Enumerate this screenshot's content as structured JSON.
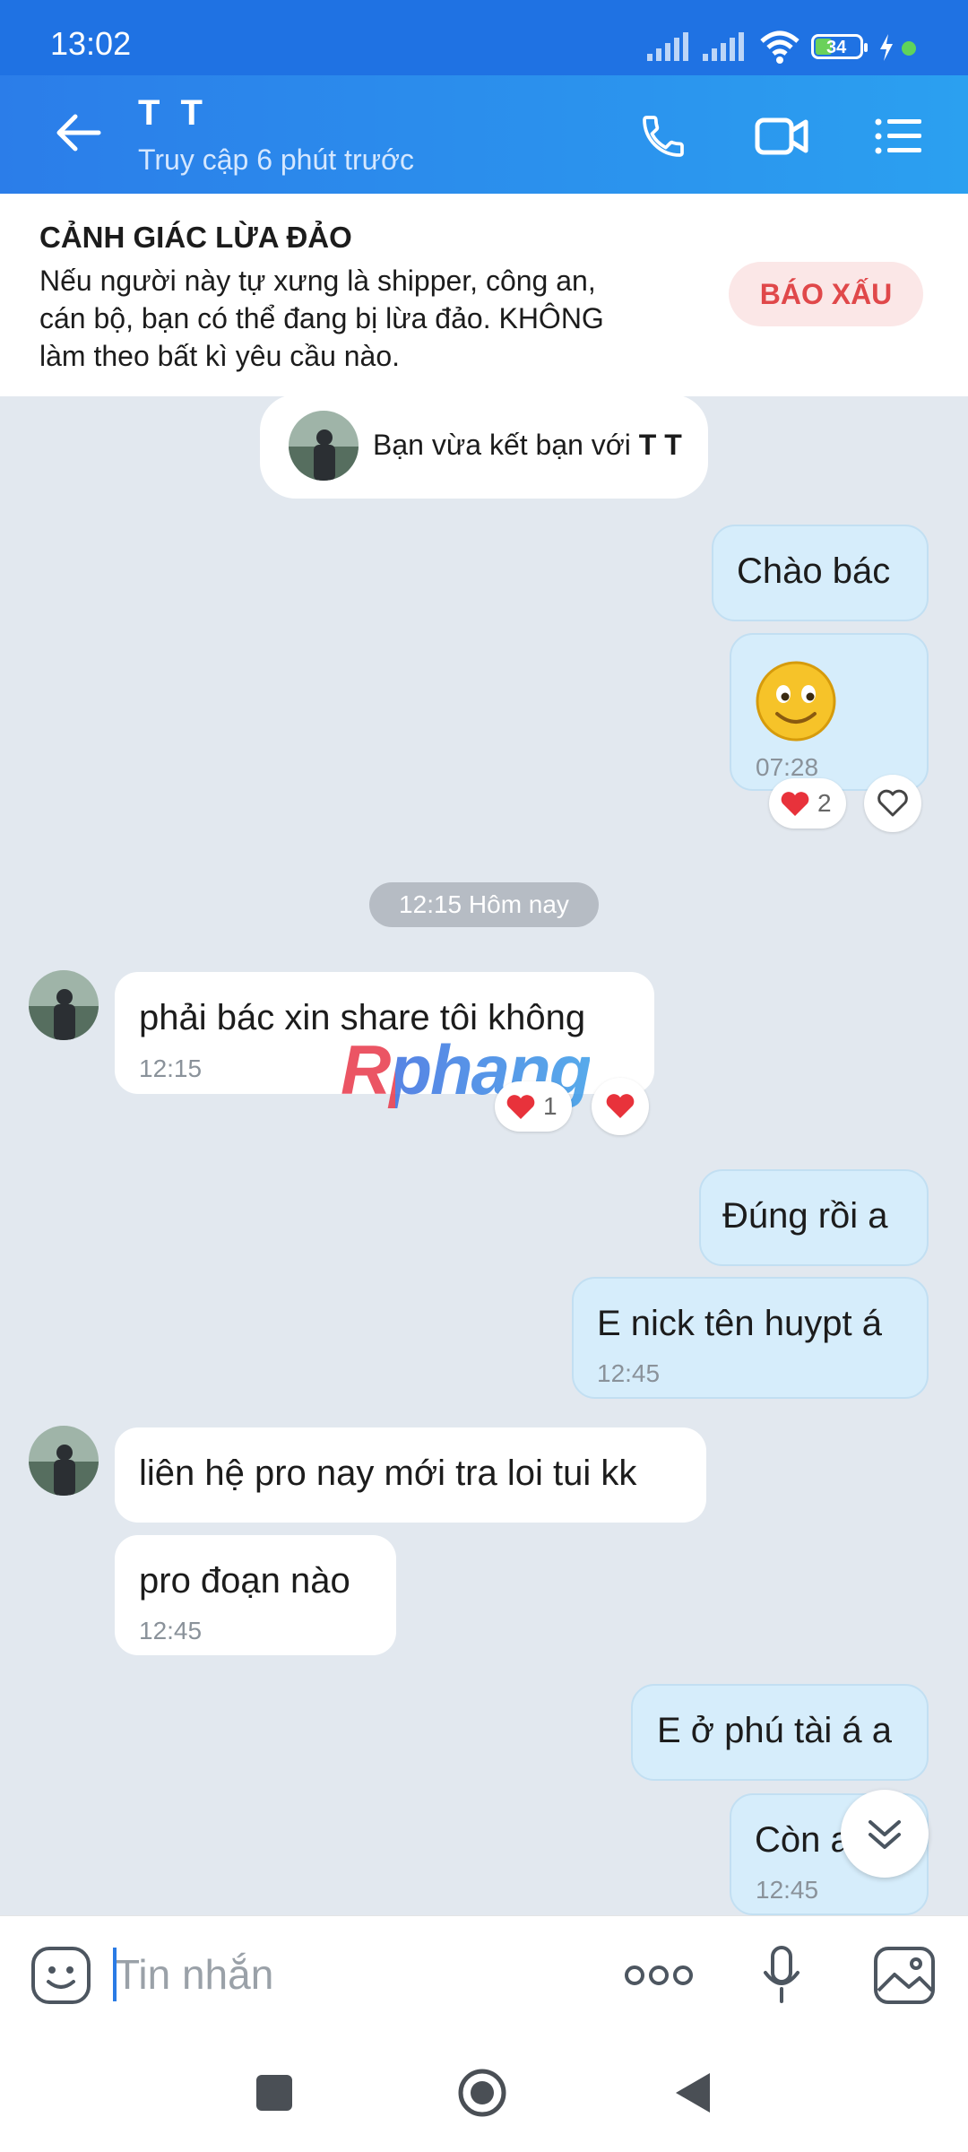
{
  "status_bar": {
    "time": "13:02",
    "battery": "34"
  },
  "header": {
    "contact_name": "T T",
    "contact_status": "Truy cập 6 phút trước"
  },
  "warning": {
    "title": "CẢNH GIÁC LỪA ĐẢO",
    "line1": "Nếu người này tự xưng là shipper, công an,",
    "line2": "cán bộ, bạn có thể đang bị lừa đảo. KHÔNG",
    "line3": "làm theo bất kì yêu cầu nào.",
    "report_label": "BÁO XẤU"
  },
  "friend_notice": {
    "prefix": "Bạn vừa kết bạn với ",
    "name": "T T"
  },
  "messages": [
    {
      "text": "Chào bác"
    },
    {
      "time": "07:28",
      "reaction_count": "2"
    },
    {
      "text": "phải bác xin share tôi không",
      "time": "12:15",
      "reaction_count": "1"
    },
    {
      "text": "Đúng rồi a"
    },
    {
      "text": "E nick tên huypt á",
      "time": "12:45"
    },
    {
      "text": "liên hệ pro nay mới tra loi tui kk"
    },
    {
      "text": "pro đoạn nào",
      "time": "12:45"
    },
    {
      "text": "E ở phú tài á a"
    },
    {
      "text": "Còn a",
      "time": "12:45"
    }
  ],
  "date_separator": "12:15 Hôm nay",
  "watermark": "Rphang",
  "input": {
    "placeholder": "Tin nhắn"
  },
  "colors": {
    "accent": "#1f72e3",
    "outgoing_bubble": "#d6edfb",
    "warning_red": "#e0484a"
  }
}
